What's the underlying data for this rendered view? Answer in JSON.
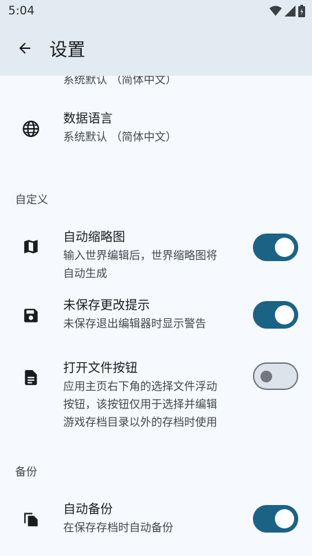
{
  "status": {
    "time": "5:04"
  },
  "appbar": {
    "title": "设置"
  },
  "items_top": {
    "partial_subtitle": "系统默认 （简体中文）"
  },
  "data_language": {
    "title": "数据语言",
    "subtitle": "系统默认 （简体中文）"
  },
  "section_custom": "自定义",
  "auto_thumbnail": {
    "title": "自动缩略图",
    "subtitle_line1": "输入世界编辑后，世界缩略图将",
    "subtitle_line2": "自动生成",
    "enabled": true
  },
  "unsaved_prompt": {
    "title": "未保存更改提示",
    "subtitle": "未保存退出编辑器时显示警告",
    "enabled": true
  },
  "open_file_button": {
    "title": "打开文件按钮",
    "subtitle_line1": "应用主页右下角的选择文件浮动",
    "subtitle_line2": "按钮，该按钮仅用于选择并编辑",
    "subtitle_line3": "游戏存档目录以外的存档时使用",
    "enabled": false
  },
  "section_backup": "备份",
  "auto_backup": {
    "title": "自动备份",
    "subtitle": "在保存存档时自动备份",
    "enabled": true
  },
  "colors": {
    "accent": "#1a6385",
    "background": "#f6fafe",
    "appbar": "#e2ebf2"
  },
  "icons": {
    "back": "arrow-back-icon",
    "globe": "globe-icon",
    "map": "map-icon",
    "save": "save-icon",
    "document": "document-icon",
    "copy": "copy-icon",
    "wifi": "wifi-icon",
    "signal": "signal-icon",
    "battery": "battery-icon"
  }
}
